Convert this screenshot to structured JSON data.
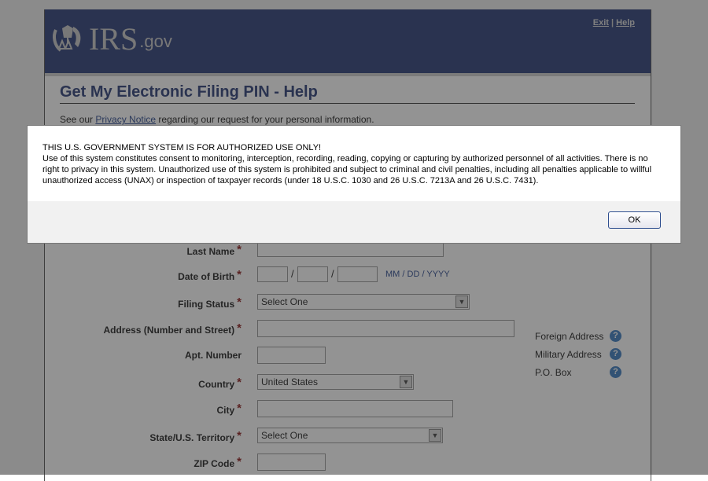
{
  "header": {
    "logo_main": "IRS",
    "logo_suffix": ".gov",
    "exit_link": "Exit",
    "separator": "|",
    "help_link": "Help"
  },
  "page": {
    "title": "Get My Electronic Filing PIN - Help",
    "privacy_prefix": "See our ",
    "privacy_link": "Privacy Notice",
    "privacy_suffix": " regarding our request for your personal information."
  },
  "form": {
    "required_marker": "*",
    "last_name": {
      "label": "Last Name",
      "value": ""
    },
    "dob": {
      "label": "Date of Birth",
      "mm": "",
      "dd": "",
      "yyyy": "",
      "separator": "/",
      "hint": "MM / DD / YYYY"
    },
    "filing_status": {
      "label": "Filing Status",
      "selected": "Select One"
    },
    "address": {
      "label": "Address (Number and Street)",
      "value": ""
    },
    "apt": {
      "label": "Apt. Number",
      "value": ""
    },
    "country": {
      "label": "Country",
      "selected": "United States"
    },
    "city": {
      "label": "City",
      "value": ""
    },
    "state": {
      "label": "State/U.S. Territory",
      "selected": "Select One"
    },
    "zip": {
      "label": "ZIP Code",
      "value": ""
    }
  },
  "side_help": [
    {
      "label": "Foreign Address",
      "icon": "help-icon",
      "glyph": "?"
    },
    {
      "label": "Military Address",
      "icon": "help-icon",
      "glyph": "?"
    },
    {
      "label": "P.O. Box",
      "icon": "help-icon",
      "glyph": "?"
    }
  ],
  "dialog": {
    "heading": "THIS U.S. GOVERNMENT SYSTEM IS FOR AUTHORIZED USE ONLY!",
    "body": "Use of this system constitutes consent to monitoring, interception, recording, reading, copying or capturing by authorized personnel of all activities.  There is no right to privacy in this system.  Unauthorized use of this system is prohibited and subject to criminal and civil penalties, including all penalties applicable to willful unauthorized access (UNAX) or inspection of taxpayer records (under 18 U.S.C. 1030 and 26 U.S.C. 7213A and 26 U.S.C. 7431).",
    "ok_label": "OK"
  },
  "colors": {
    "header_bg": "#2d3e78",
    "title": "#2d3e78",
    "required": "#8b1a1a",
    "link": "#2d4a8f",
    "help_icon": "#3d7cc0"
  }
}
